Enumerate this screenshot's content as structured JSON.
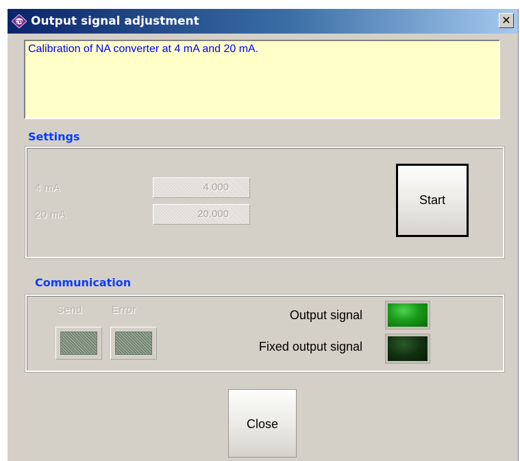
{
  "window": {
    "title": "Output signal adjustment",
    "close_glyph": "✕"
  },
  "description": {
    "text": "Calibration of NA converter at 4 mA and 20 mA."
  },
  "settings": {
    "section_title": "Settings",
    "rows": [
      {
        "label": "4 mA",
        "value": "4.000"
      },
      {
        "label": "20 mA",
        "value": "20.000"
      }
    ],
    "start_button": "Start"
  },
  "communication": {
    "section_title": "Communication",
    "send_label": "Send",
    "error_label": "Error",
    "output_signal_label": "Output signal",
    "fixed_output_signal_label": "Fixed output signal",
    "output_signal_state": "on",
    "fixed_output_signal_state": "off"
  },
  "close_button": "Close",
  "colors": {
    "titlebar_start": "#0a246a",
    "titlebar_end": "#a6caf0",
    "description_bg": "#ffffc8",
    "description_text": "#0000ff",
    "section_title": "#0a3cff",
    "led_on": "#1a8c1a",
    "led_off": "#0f2a0f"
  },
  "icons": {
    "app": "app-logo-icon",
    "close": "close-icon"
  }
}
